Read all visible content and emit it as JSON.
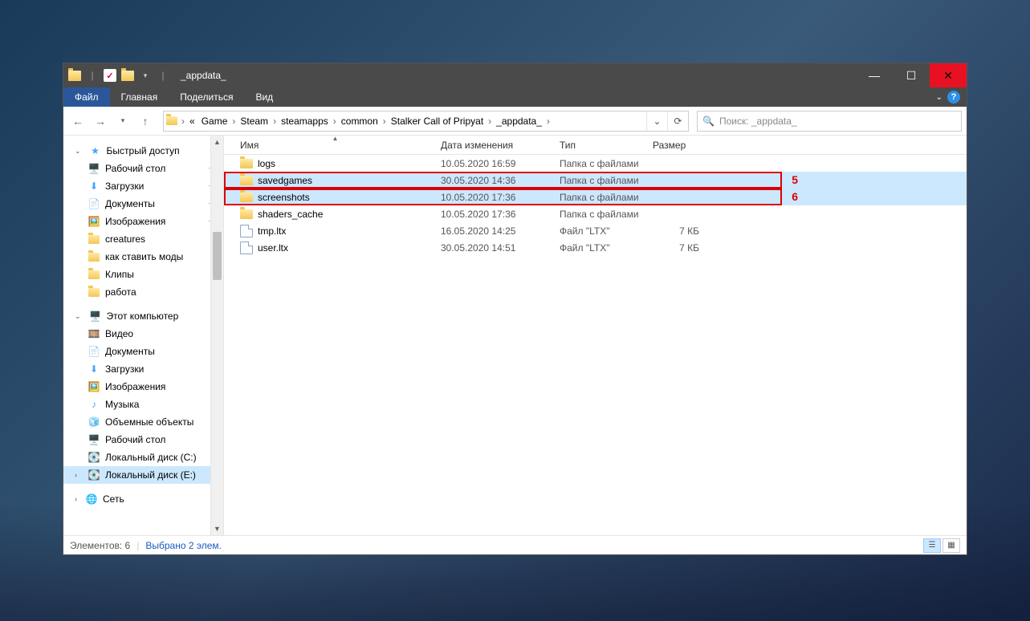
{
  "window": {
    "title": "_appdata_"
  },
  "ribbon": {
    "file": "Файл",
    "home": "Главная",
    "share": "Поделиться",
    "view": "Вид"
  },
  "breadcrumb": {
    "overflow": "«",
    "segs": [
      "Game",
      "Steam",
      "steamapps",
      "common",
      "Stalker Call of Pripyat",
      "_appdata_"
    ]
  },
  "search": {
    "placeholder": "Поиск: _appdata_"
  },
  "sidebar": {
    "quick_access": "Быстрый доступ",
    "qa_items": [
      {
        "label": "Рабочий стол",
        "icon": "desktop",
        "pin": true
      },
      {
        "label": "Загрузки",
        "icon": "download",
        "pin": true
      },
      {
        "label": "Документы",
        "icon": "doc",
        "pin": true
      },
      {
        "label": "Изображения",
        "icon": "pic",
        "pin": true
      },
      {
        "label": "creatures",
        "icon": "folder",
        "pin": false
      },
      {
        "label": "как ставить моды",
        "icon": "folder",
        "pin": false
      },
      {
        "label": "Клипы",
        "icon": "folder",
        "pin": false
      },
      {
        "label": "работа",
        "icon": "folder",
        "pin": false
      }
    ],
    "this_pc": "Этот компьютер",
    "pc_items": [
      {
        "label": "Видео",
        "icon": "video"
      },
      {
        "label": "Документы",
        "icon": "doc"
      },
      {
        "label": "Загрузки",
        "icon": "download"
      },
      {
        "label": "Изображения",
        "icon": "pic"
      },
      {
        "label": "Музыка",
        "icon": "music"
      },
      {
        "label": "Объемные объекты",
        "icon": "3d"
      },
      {
        "label": "Рабочий стол",
        "icon": "desktop"
      },
      {
        "label": "Локальный диск (C:)",
        "icon": "disk"
      },
      {
        "label": "Локальный диск (E:)",
        "icon": "disk",
        "selected": true
      }
    ],
    "network": "Сеть"
  },
  "columns": {
    "name": "Имя",
    "date": "Дата изменения",
    "type": "Тип",
    "size": "Размер"
  },
  "files": [
    {
      "name": "logs",
      "date": "10.05.2020 16:59",
      "type": "Папка с файлами",
      "size": "",
      "icon": "folder"
    },
    {
      "name": "savedgames",
      "date": "30.05.2020 14:36",
      "type": "Папка с файлами",
      "size": "",
      "icon": "folder",
      "selected": true,
      "annot": "5"
    },
    {
      "name": "screenshots",
      "date": "10.05.2020 17:36",
      "type": "Папка с файлами",
      "size": "",
      "icon": "folder",
      "selected": true,
      "annot": "6"
    },
    {
      "name": "shaders_cache",
      "date": "10.05.2020 17:36",
      "type": "Папка с файлами",
      "size": "",
      "icon": "folder"
    },
    {
      "name": "tmp.ltx",
      "date": "16.05.2020 14:25",
      "type": "Файл \"LTX\"",
      "size": "7 КБ",
      "icon": "file"
    },
    {
      "name": "user.ltx",
      "date": "30.05.2020 14:51",
      "type": "Файл \"LTX\"",
      "size": "7 КБ",
      "icon": "file"
    }
  ],
  "status": {
    "count": "Элементов: 6",
    "selection": "Выбрано 2 элем."
  }
}
